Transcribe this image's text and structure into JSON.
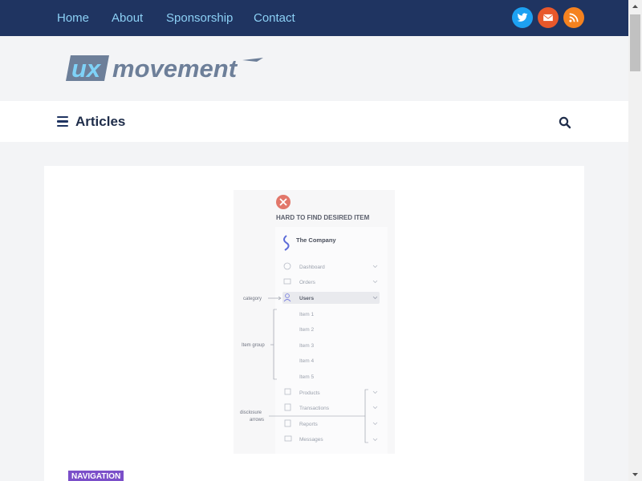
{
  "nav": {
    "items": [
      {
        "label": "Home"
      },
      {
        "label": "About"
      },
      {
        "label": "Sponsorship"
      },
      {
        "label": "Contact"
      }
    ],
    "social": [
      {
        "icon": "twitter-icon",
        "color": "#1da1f2"
      },
      {
        "icon": "envelope-icon",
        "color": "#e8582b"
      },
      {
        "icon": "rss-icon",
        "color": "#f5821f"
      }
    ],
    "bg_color": "#1f3461"
  },
  "logo": {
    "part1": "ux",
    "part2": "movement",
    "color": "#6d7f99",
    "accent": "#7fd2f7"
  },
  "section": {
    "title": "Articles",
    "menu_icon": "hamburger-icon",
    "search_icon": "search-icon"
  },
  "figure": {
    "heading": "HARD TO FIND DESIRED ITEM",
    "status_icon": "x-circle-icon",
    "company": "The Company",
    "menu": [
      {
        "label": "Dashboard"
      },
      {
        "label": "Orders"
      },
      {
        "label": "Users",
        "selected": true
      },
      {
        "label": "Item 1"
      },
      {
        "label": "Item 2"
      },
      {
        "label": "Item 3"
      },
      {
        "label": "Item 4"
      },
      {
        "label": "Item 5"
      },
      {
        "label": "Products"
      },
      {
        "label": "Transactions"
      },
      {
        "label": "Reports"
      },
      {
        "label": "Messages"
      }
    ],
    "annotations": {
      "category": "category",
      "item_group": "Item group",
      "disclosure_1": "disclosure",
      "disclosure_2": "arrows"
    }
  },
  "tag": {
    "label": "NAVIGATION",
    "color": "#7b4fc9"
  }
}
